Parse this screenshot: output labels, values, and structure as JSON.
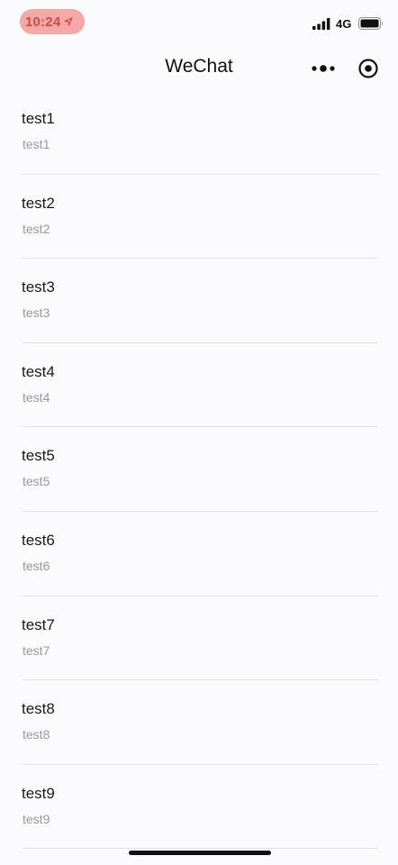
{
  "status_bar": {
    "time": "10:24",
    "network": "4G"
  },
  "nav": {
    "title": "WeChat"
  },
  "list": {
    "items": [
      {
        "title": "test1",
        "subtitle": "test1"
      },
      {
        "title": "test2",
        "subtitle": "test2"
      },
      {
        "title": "test3",
        "subtitle": "test3"
      },
      {
        "title": "test4",
        "subtitle": "test4"
      },
      {
        "title": "test5",
        "subtitle": "test5"
      },
      {
        "title": "test6",
        "subtitle": "test6"
      },
      {
        "title": "test7",
        "subtitle": "test7"
      },
      {
        "title": "test8",
        "subtitle": "test8"
      },
      {
        "title": "test9",
        "subtitle": "test9"
      }
    ]
  },
  "icons": {
    "location": "location-arrow-icon",
    "signal": "signal-bars-icon",
    "battery": "battery-icon",
    "more": "more-dots-icon",
    "close": "target-circle-icon"
  },
  "colors": {
    "time_pill_bg": "#f3a9a6",
    "time_text": "#d14a44",
    "background": "#fbfbfd",
    "subtitle": "#9a9a9a",
    "divider": "#e3e3e3"
  }
}
